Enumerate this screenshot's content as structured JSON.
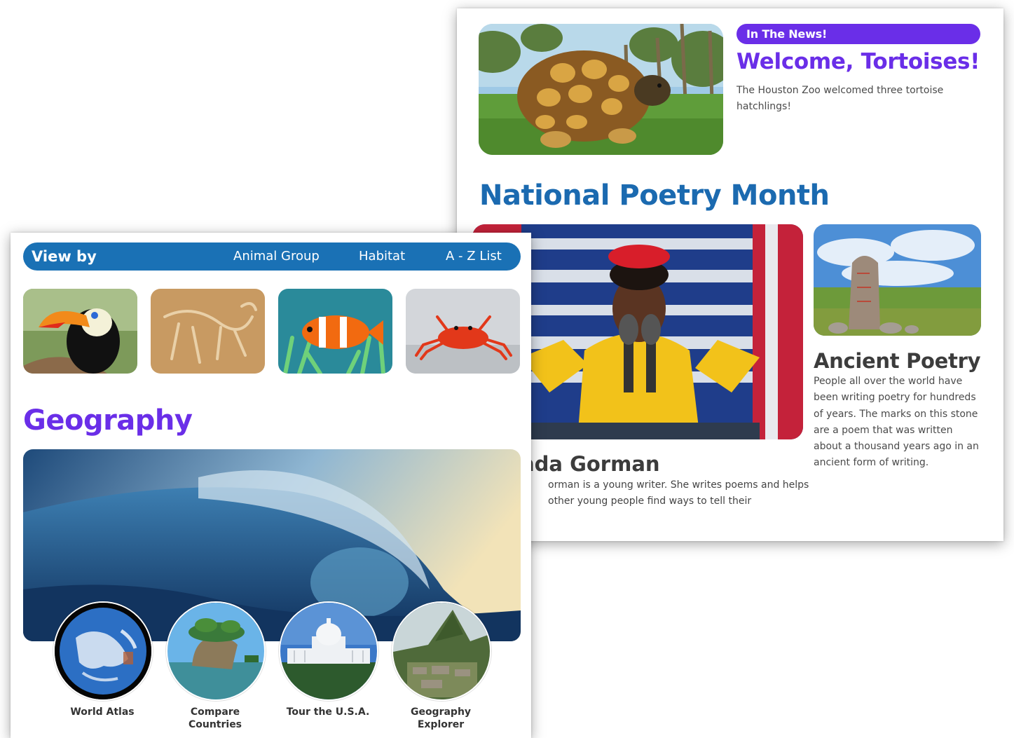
{
  "back_panel": {
    "news": {
      "badge": "In The News!",
      "title": "Welcome, Tortoises!",
      "description": "The Houston Zoo welcomed three tortoise hatchlings!",
      "image_icon": "tortoise-photo"
    },
    "poetry": {
      "heading": "National Poetry Month",
      "feature": {
        "name": "nda Gorman",
        "description": "orman is a young writer. She writes poems and helps other young people find ways to tell their",
        "image_icon": "poet-at-podium-photo"
      },
      "ancient": {
        "title": "Ancient Poetry",
        "description": "People all over the world have been writing poetry for hundreds of years. The marks on this stone are a poem that was written about a thousand years ago in an ancient form of writing.",
        "image_icon": "runestone-photo"
      }
    }
  },
  "front_panel": {
    "view_by": {
      "label": "View by",
      "links": [
        "Animal Group",
        "Habitat",
        "A - Z List"
      ]
    },
    "animal_thumbnails": [
      "toucan",
      "fossil",
      "clownfish",
      "crab"
    ],
    "geography": {
      "heading": "Geography",
      "hero_icon": "ocean-wave-photo",
      "items": [
        {
          "label": "World Atlas",
          "icon": "earth-globe"
        },
        {
          "label": "Compare Countries",
          "icon": "rock-island"
        },
        {
          "label": "Tour the U.S.A.",
          "icon": "capitol-building"
        },
        {
          "label": "Geography Explorer",
          "icon": "machu-picchu"
        }
      ]
    }
  },
  "colors": {
    "purple_accent": "#6a2ee8",
    "blue_accent": "#1b6ab0",
    "nav_bar": "#1a71b5"
  }
}
